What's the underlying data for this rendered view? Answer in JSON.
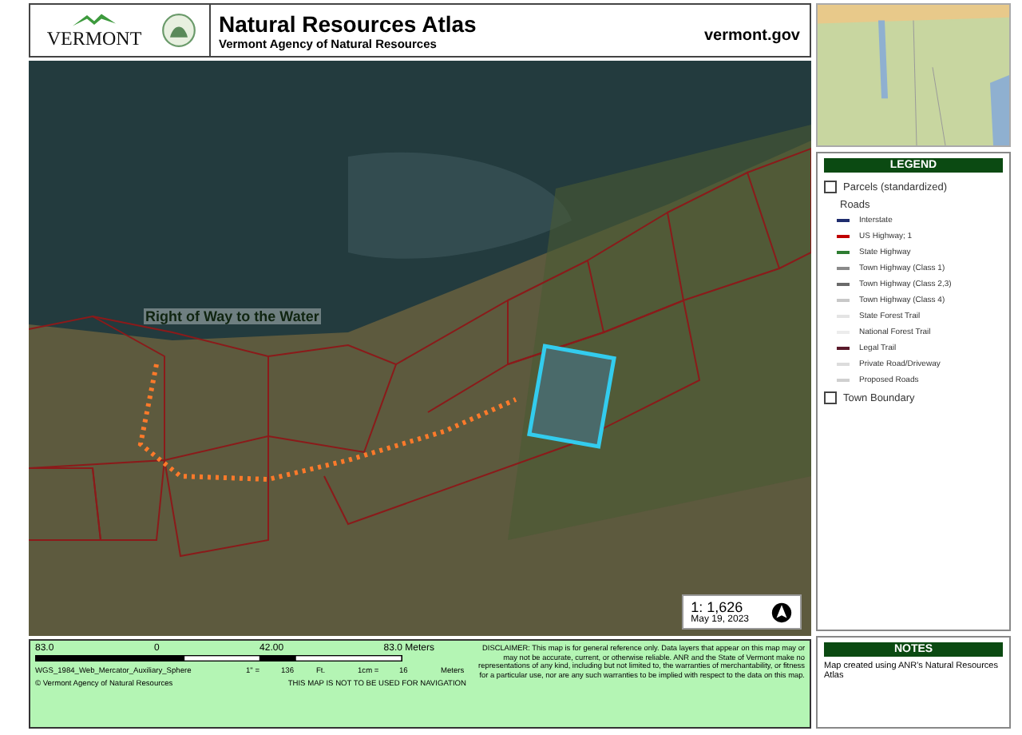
{
  "header": {
    "logo_text": "VERMONT",
    "title": "Natural Resources Atlas",
    "subtitle": "Vermont Agency of Natural Resources",
    "website": "vermont.gov"
  },
  "map": {
    "annotation": "Right of Way to the Water",
    "scale": "1: 1,626",
    "date": "May 19, 2023"
  },
  "legend": {
    "title": "LEGEND",
    "items": [
      {
        "kind": "box",
        "label": "Parcels (standardized)"
      },
      {
        "kind": "heading",
        "label": "Roads"
      },
      {
        "kind": "line",
        "label": "Interstate",
        "color": "#1f2d6e"
      },
      {
        "kind": "line",
        "label": "US Highway; 1",
        "color": "#c00000"
      },
      {
        "kind": "line",
        "label": "State Highway",
        "color": "#2e7d32"
      },
      {
        "kind": "line",
        "label": "Town Highway (Class 1)",
        "color": "#8a8a8a"
      },
      {
        "kind": "line",
        "label": "Town Highway (Class 2,3)",
        "color": "#6a6a6a"
      },
      {
        "kind": "line",
        "label": "Town Highway (Class 4)",
        "color": "#c8c8c8"
      },
      {
        "kind": "line",
        "label": "State Forest Trail",
        "color": "#e4e4e4"
      },
      {
        "kind": "line",
        "label": "National Forest Trail",
        "color": "#ececec"
      },
      {
        "kind": "line",
        "label": "Legal Trail",
        "color": "#5a1a2a"
      },
      {
        "kind": "line",
        "label": "Private Road/Driveway",
        "color": "#dcdcdc"
      },
      {
        "kind": "line",
        "label": "Proposed Roads",
        "color": "#d0d0d0"
      },
      {
        "kind": "box",
        "label": "Town Boundary"
      }
    ]
  },
  "scale_bar": {
    "labels": [
      "83.0",
      "0",
      "42.00",
      "83.0 Meters"
    ],
    "projection": "WGS_1984_Web_Mercator_Auxiliary_Sphere",
    "inch_label": "1\" =",
    "inch_value": "136",
    "inch_unit": "Ft.",
    "cm_label": "1cm =",
    "cm_value": "16",
    "cm_unit": "Meters",
    "copyright": "© Vermont Agency of Natural Resources",
    "warning": "THIS MAP IS NOT TO BE USED FOR NAVIGATION",
    "disclaimer": "DISCLAIMER: This map is for general reference only. Data layers that appear on this map may or may not be accurate, current, or otherwise reliable. ANR and the State of Vermont make no representations of any kind, including but not limited to, the warranties of merchantability, or fitness for a particular use, nor are any such warranties to be implied with respect to the data on this map."
  },
  "notes": {
    "title": "NOTES",
    "text": "Map created using ANR's Natural Resources Atlas"
  }
}
